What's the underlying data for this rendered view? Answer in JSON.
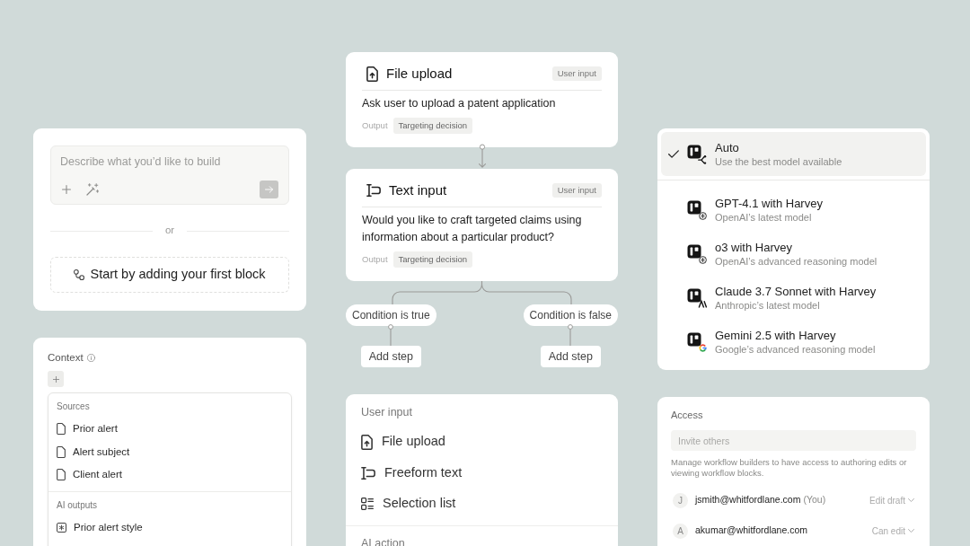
{
  "builder": {
    "prompt": {
      "placeholder": "Describe what you’d like to build"
    },
    "divider_label": "or",
    "start_button": {
      "label": "Start by adding your first block"
    }
  },
  "context": {
    "title": "Context",
    "groups": [
      {
        "heading": "Sources",
        "items": [
          {
            "label": "Prior alert",
            "kind": "source"
          },
          {
            "label": "Alert subject",
            "kind": "source"
          },
          {
            "label": "Client alert",
            "kind": "source"
          }
        ]
      },
      {
        "heading": "AI outputs",
        "items": [
          {
            "label": "Prior alert style",
            "kind": "ai_output"
          }
        ]
      }
    ]
  },
  "workflow": {
    "blocks": [
      {
        "kind": "file_upload",
        "title": "File upload",
        "badge": "User input",
        "description": "Ask user to upload a patent application",
        "output_label": "Output",
        "output_value": "Targeting decision"
      },
      {
        "kind": "text_input",
        "title": "Text input",
        "badge": "User input",
        "description": "Would you like to craft targeted claims using information about a particular product?",
        "output_label": "Output",
        "output_value": "Targeting decision"
      }
    ],
    "branches": [
      {
        "condition": "Condition is true",
        "action": "Add step"
      },
      {
        "condition": "Condition is false",
        "action": "Add step"
      }
    ]
  },
  "block_menu": {
    "sections": [
      {
        "heading": "User input",
        "items": [
          {
            "label": "File upload",
            "kind": "file_upload"
          },
          {
            "label": "Freeform text",
            "kind": "text_input"
          },
          {
            "label": "Selection list",
            "kind": "selection_list"
          }
        ]
      },
      {
        "heading": "AI action"
      }
    ]
  },
  "model_menu": {
    "models": [
      {
        "kind": "auto",
        "name": "Auto",
        "description": "Use the best model available",
        "selected": true
      },
      {
        "kind": "openai",
        "name": "GPT-4.1 with Harvey",
        "description": "OpenAI’s latest model",
        "selected": false
      },
      {
        "kind": "openai",
        "name": "o3 with Harvey",
        "description": "OpenAI’s advanced reasoning model",
        "selected": false
      },
      {
        "kind": "anthropic",
        "name": "Claude 3.7 Sonnet with Harvey",
        "description": "Anthropic’s latest model",
        "selected": false
      },
      {
        "kind": "google",
        "name": "Gemini 2.5 with Harvey",
        "description": "Google’s advanced reasoning model",
        "selected": false
      }
    ]
  },
  "access": {
    "title": "Access",
    "invite": {
      "placeholder": "Invite others"
    },
    "note": "Manage workflow builders to have access to authoring edits or viewing workflow blocks.",
    "members": [
      {
        "initial": "J",
        "email": "jsmith@whitfordlane.com",
        "tag": "(You)",
        "role": "Edit draft"
      },
      {
        "initial": "A",
        "email": "akumar@whitfordlane.com",
        "role": "Can edit"
      }
    ]
  }
}
